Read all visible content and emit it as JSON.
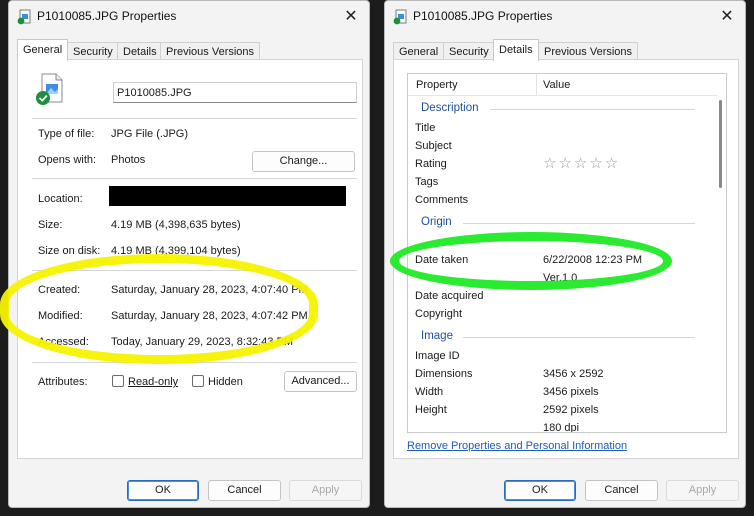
{
  "left": {
    "title": "P1010085.JPG Properties",
    "tabs": [
      "General",
      "Security",
      "Details",
      "Previous Versions"
    ],
    "active_tab": "General",
    "file_name": "P1010085.JPG",
    "type_label": "Type of file:",
    "type_value": "JPG File (.JPG)",
    "opens_label": "Opens with:",
    "opens_value": "Photos",
    "change_button": "Change...",
    "location_label": "Location:",
    "size_label": "Size:",
    "size_value": "4.19 MB (4,398,635 bytes)",
    "size_disk_label": "Size on disk:",
    "size_disk_value": "4.19 MB (4,399,104 bytes)",
    "created_label": "Created:",
    "created_value": "Saturday, January 28, 2023, 4:07:40 PM",
    "modified_label": "Modified:",
    "modified_value": "Saturday, January 28, 2023, 4:07:42 PM",
    "accessed_label": "Accessed:",
    "accessed_value": "Today, January 29, 2023, 8:32:43 PM",
    "attributes_label": "Attributes:",
    "readonly_label": "Read-only",
    "hidden_label": "Hidden",
    "advanced_button": "Advanced...",
    "ok_button": "OK",
    "cancel_button": "Cancel",
    "apply_button": "Apply"
  },
  "right": {
    "title": "P1010085.JPG Properties",
    "tabs": [
      "General",
      "Security",
      "Details",
      "Previous Versions"
    ],
    "active_tab": "Details",
    "col_property": "Property",
    "col_value": "Value",
    "group_description": "Description",
    "title_label": "Title",
    "subject_label": "Subject",
    "rating_label": "Rating",
    "rating_value": 0,
    "rating_max": 5,
    "rating_stars": "☆☆☆☆☆",
    "tags_label": "Tags",
    "comments_label": "Comments",
    "group_origin": "Origin",
    "date_taken_label": "Date taken",
    "date_taken_value": "6/22/2008 12:23 PM",
    "program_name_value": "Ver.1.0",
    "date_acquired_label": "Date acquired",
    "copyright_label": "Copyright",
    "group_image": "Image",
    "image_id_label": "Image ID",
    "dimensions_label": "Dimensions",
    "dimensions_value": "3456 x 2592",
    "width_label": "Width",
    "width_value": "3456 pixels",
    "height_label": "Height",
    "height_value": "2592 pixels",
    "horiz_res_value": "180 dpi",
    "remove_link": "Remove Properties and Personal Information",
    "ok_button": "OK",
    "cancel_button": "Cancel",
    "apply_button": "Apply"
  },
  "colors": {
    "highlight_yellow": "#f6f200",
    "highlight_green": "#1fea24",
    "group_heading": "#1c4f9c",
    "link": "#1d5bb8"
  },
  "icons": [
    "file-properties-icon",
    "close-icon",
    "jpg-file-icon",
    "shared-check-icon",
    "star-icon"
  ]
}
